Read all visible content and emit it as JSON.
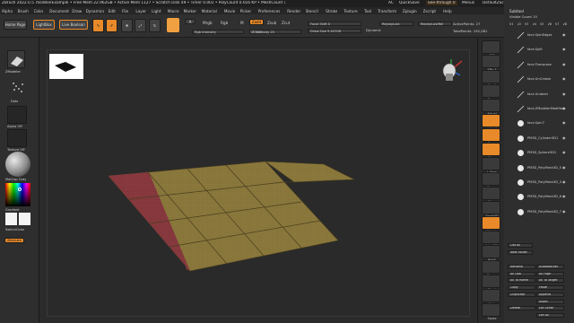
{
  "titlebar": {
    "app": "ZBrush 2022.0.5",
    "project": "modelerExample",
    "stats": "• Free Mem 22.962GB • Active Mem 1127 • Scratch Disk 49 • Timer 0.001 • PolyCount 0.016 KP • MeshCount 1",
    "ac": "AC",
    "quicksave": "QuickSave",
    "seethrough": "See-through 0",
    "menus_label": "Menus",
    "script": "DefaultZScript"
  },
  "menubar": [
    "Alpha",
    "Brush",
    "Color",
    "Document",
    "Draw",
    "Dynamics",
    "Edit",
    "File",
    "Layer",
    "Light",
    "Macro",
    "Marker",
    "Material",
    "Movie",
    "Picker",
    "Preferences",
    "Render",
    "Stencil",
    "Stroke",
    "Texture",
    "Tool",
    "Transform",
    "Zplugin",
    "Zscript",
    "Help"
  ],
  "shelf": {
    "home": "Home Page",
    "lightbox": "LightBox",
    "liveboolean": "Live Boolean",
    "tools": [
      "Edit",
      "Draw",
      "Move",
      "Scale",
      "Rotate"
    ],
    "mrgb": "Mrgb",
    "rgb": "Rgb",
    "m": "M",
    "zadd": "Zadd",
    "zsub": "Zsub",
    "zcut": "Zcut",
    "rgb_intensity": "Rgb Intensity",
    "z_intensity": "Z Intensity 25",
    "focal_shift": "Focal Shift 0",
    "draw_size": "Draw Size 9.44708",
    "dynamic": "Dynamic",
    "replay_last": "ReplayLast",
    "replay_last_rel": "ReplayLastRel",
    "active_points": "ActivePoints: 27",
    "total_points": "TotalPoints: 192,081"
  },
  "left": {
    "mesh_label": "ZModeler",
    "dots_label": "Dots",
    "alpha_label": "Alpha Off",
    "texture_label": "Texture Off",
    "material_label": "MatCap Gray",
    "gradient_label": "Gradient",
    "switch_label": "SwitchColor",
    "alternate_label": "Alternate"
  },
  "right_icons": [
    "BPR",
    "SPix 3",
    "Scroll",
    "Zoom",
    "Actual",
    "AAHalf",
    "Persp",
    "Floor",
    "L.Sym",
    "Frame",
    "Move",
    "Zoom3D",
    "Rotate",
    "Line Fill",
    "PolyF",
    "Transp",
    "Ghost",
    "Solo",
    "Xpose"
  ],
  "subtool": {
    "title": "Subtool",
    "visible_count": "Visible Count 15",
    "levels": [
      "V1",
      "V2",
      "V3",
      "V4",
      "V5",
      "V6",
      "V7",
      "V8"
    ],
    "items": [
      {
        "name": "face.SpinEdges",
        "type": "brush"
      },
      {
        "name": "face.Split",
        "type": "brush"
      },
      {
        "name": "face.Transpose",
        "type": "brush"
      },
      {
        "name": "face.UnCrease",
        "type": "brush"
      },
      {
        "name": "face.Undeed",
        "type": "brush"
      },
      {
        "name": "face.ZModelerModifiers",
        "type": "brush"
      },
      {
        "name": "face.Spin7",
        "type": "mesh"
      },
      {
        "name": "PM3D_Cylinder3D1",
        "type": "mesh"
      },
      {
        "name": "PM3D_Sphere3D1",
        "type": "mesh"
      },
      {
        "name": "PM3D_PolyMesh3D_5",
        "type": "mesh"
      },
      {
        "name": "PM3D_PolyMesh3D_3",
        "type": "mesh"
      },
      {
        "name": "PM3D_PolyMesh3D_6",
        "type": "mesh"
      },
      {
        "name": "PM3D_PolyMesh3D_7",
        "type": "mesh"
      }
    ],
    "list_all": "List All",
    "new_folder": "New Folder",
    "buttons": [
      [
        "Rename",
        "AutoReorder"
      ],
      [
        "All Low",
        "All High"
      ],
      [
        "All To Home",
        "All To Target"
      ],
      [
        "Copy",
        "Paste"
      ],
      [
        "Duplicate",
        "Append"
      ],
      [
        "",
        "Insert"
      ],
      [
        "Delete",
        "Del Other"
      ],
      [
        "",
        "Del All"
      ]
    ]
  },
  "colors": {
    "accent": "#e88a2a",
    "mesh_fill": "#8d7a3d",
    "mesh_grid": "#5a4e28",
    "masked_fill": "#8a3a3f"
  }
}
